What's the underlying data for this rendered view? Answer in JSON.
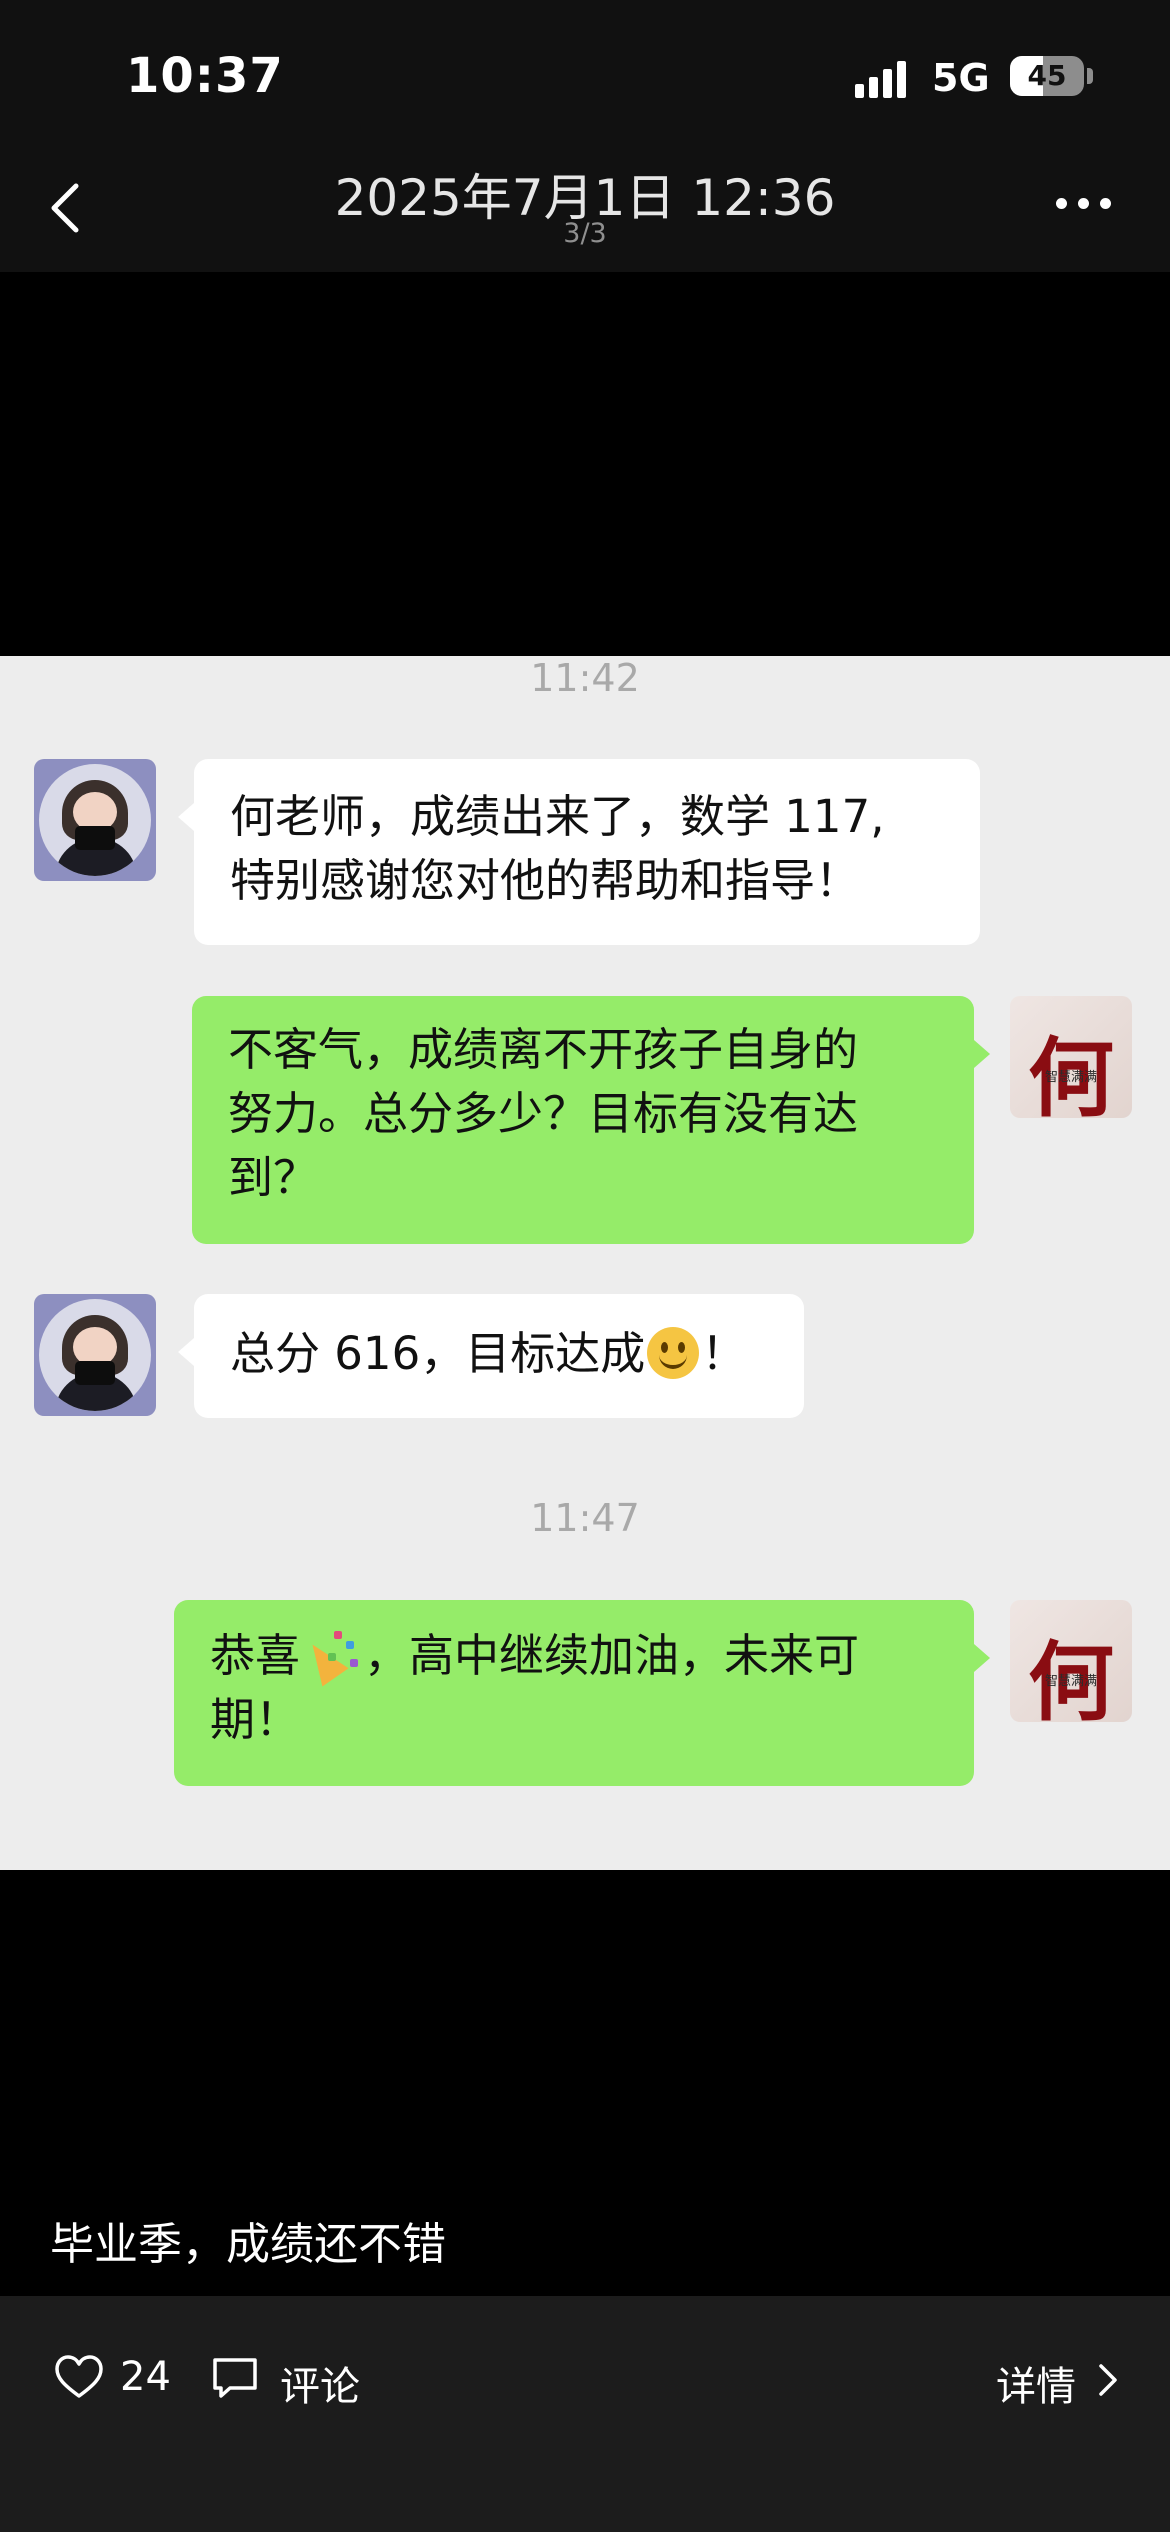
{
  "status_bar": {
    "time": "10:37",
    "network": "5G",
    "battery_percent": 45,
    "battery_label": "45"
  },
  "header": {
    "title": "2025年7月1日 12:36",
    "page_indicator": "3/3"
  },
  "chat": {
    "times": [
      "11:42",
      "11:47"
    ],
    "messages": [
      {
        "sender": "parent",
        "lines": [
          "何老师，成绩出来了，数学 117,",
          "特别感谢您对他的帮助和指导！"
        ]
      },
      {
        "sender": "teacher",
        "lines": [
          "不客气，成绩离不开孩子自身的",
          "努力。总分多少？目标有没有达",
          "到？"
        ]
      },
      {
        "sender": "parent",
        "lines": [
          "总分 616，目标达成",
          "！"
        ],
        "emoji": "smiling-face"
      },
      {
        "sender": "teacher",
        "lines": [
          "恭喜",
          "，高中继续加油，未来可",
          "期！"
        ],
        "emoji": "party-popper"
      }
    ],
    "teacher_avatar_char": "何",
    "teacher_avatar_stamp": "智慧满满"
  },
  "caption": "毕业季，成绩还不错",
  "actions": {
    "like_count": "24",
    "comment_label": "评论",
    "detail_label": "详情"
  },
  "colors": {
    "chat_bg": "#ededed",
    "bubble_in": "#ffffff",
    "bubble_out": "#95ec69",
    "accent_text": "#8a0d12"
  }
}
